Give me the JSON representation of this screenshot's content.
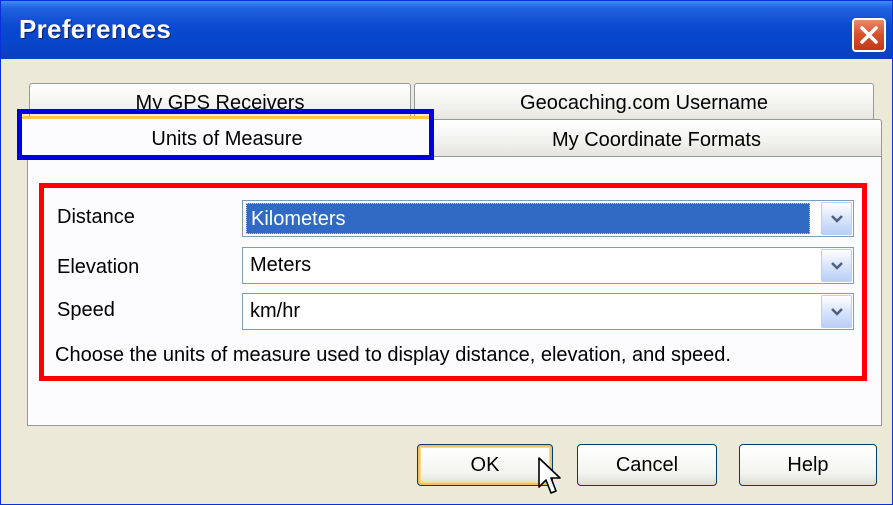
{
  "window": {
    "title": "Preferences",
    "close_icon": "close-icon"
  },
  "tabs": {
    "back_row": [
      {
        "label": "My GPS Receivers"
      },
      {
        "label": "Geocaching.com Username"
      }
    ],
    "front_row": [
      {
        "label": "Units of Measure",
        "active": true
      },
      {
        "label": "My Coordinate Formats"
      }
    ]
  },
  "units": {
    "distance": {
      "label": "Distance",
      "value": "Kilometers"
    },
    "elevation": {
      "label": "Elevation",
      "value": "Meters"
    },
    "speed": {
      "label": "Speed",
      "value": "km/hr"
    },
    "hint": "Choose the units of measure used to display distance, elevation, and speed."
  },
  "buttons": {
    "ok": "OK",
    "cancel": "Cancel",
    "help": "Help"
  },
  "colors": {
    "titlebar": "#0a49d0",
    "highlight_tab": "#0000dd",
    "highlight_panel": "#ff0000",
    "selection": "#316ac5"
  }
}
